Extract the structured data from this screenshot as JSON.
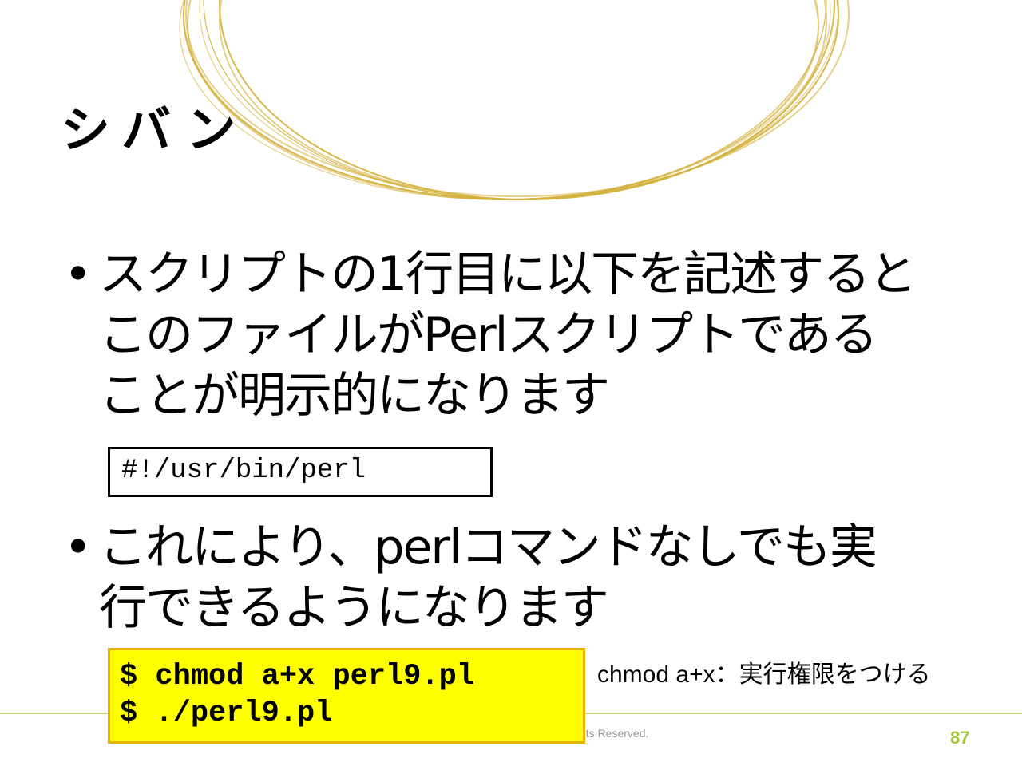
{
  "slide": {
    "title": "シバン",
    "bullets": [
      {
        "symbol": "•",
        "lines": [
          "スクリプトの1行目に以下を記述すると",
          "このファイルがPerlスクリプトである",
          "ことが明示的になります"
        ]
      },
      {
        "symbol": "•",
        "lines": [
          "これにより、perlコマンドなしでも実",
          "行できるようになります"
        ]
      }
    ],
    "shebang": "#!/usr/bin/perl",
    "commands": [
      "$ chmod a+x perl9.pl",
      "$ ./perl9.pl"
    ],
    "note": "chmod a+x：実行権限をつける",
    "footer_text": "hts Reserved.",
    "page_number": "87"
  },
  "colors": {
    "ring": "#d4b13c",
    "highlight": "#ffff00",
    "highlight_border": "#e8b000",
    "page_number": "#a4c639",
    "rule": "#c9d87a"
  }
}
